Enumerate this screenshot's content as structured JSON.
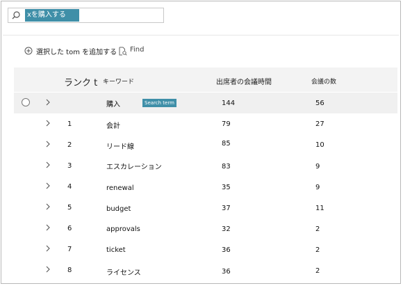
{
  "search": {
    "token": "xを購入する",
    "placeholder": ""
  },
  "commands": {
    "add_label": "選択した tom を追加する",
    "find_label": "Find"
  },
  "table": {
    "headers": {
      "rank": "ランク t",
      "keyword": "キーワード",
      "attendee_meeting_time": "出席者の会議時間",
      "meeting_count": "会議の数"
    },
    "selected_row": {
      "keyword": "購入",
      "badge": "Search term",
      "attendee_meeting_time": "144",
      "meeting_count": "56"
    },
    "rows": [
      {
        "rank": "1",
        "keyword": "会計",
        "attendee_meeting_time": "79",
        "meeting_count": "27"
      },
      {
        "rank": "2",
        "keyword": "リード線",
        "attendee_meeting_time": "85",
        "meeting_count": "10"
      },
      {
        "rank": "3",
        "keyword": "エスカレーション",
        "attendee_meeting_time": "83",
        "meeting_count": "9"
      },
      {
        "rank": "4",
        "keyword": "renewal",
        "attendee_meeting_time": "35",
        "meeting_count": "9"
      },
      {
        "rank": "5",
        "keyword": "budget",
        "attendee_meeting_time": "37",
        "meeting_count": "11"
      },
      {
        "rank": "6",
        "keyword": "approvals",
        "attendee_meeting_time": "32",
        "meeting_count": "2"
      },
      {
        "rank": "7",
        "keyword": "ticket",
        "attendee_meeting_time": "36",
        "meeting_count": "2"
      },
      {
        "rank": "8",
        "keyword": "ライセンス",
        "attendee_meeting_time": "36",
        "meeting_count": "2"
      }
    ]
  },
  "icons": {
    "search": "search-icon",
    "add": "add-circle-icon",
    "find": "find-document-icon",
    "expand": "chevron-right-icon",
    "select": "radio-circle-icon"
  },
  "colors": {
    "accent": "#3f8fa8",
    "header_bg": "#f3f3f3",
    "selected_row_bg": "#f0f0f0"
  }
}
